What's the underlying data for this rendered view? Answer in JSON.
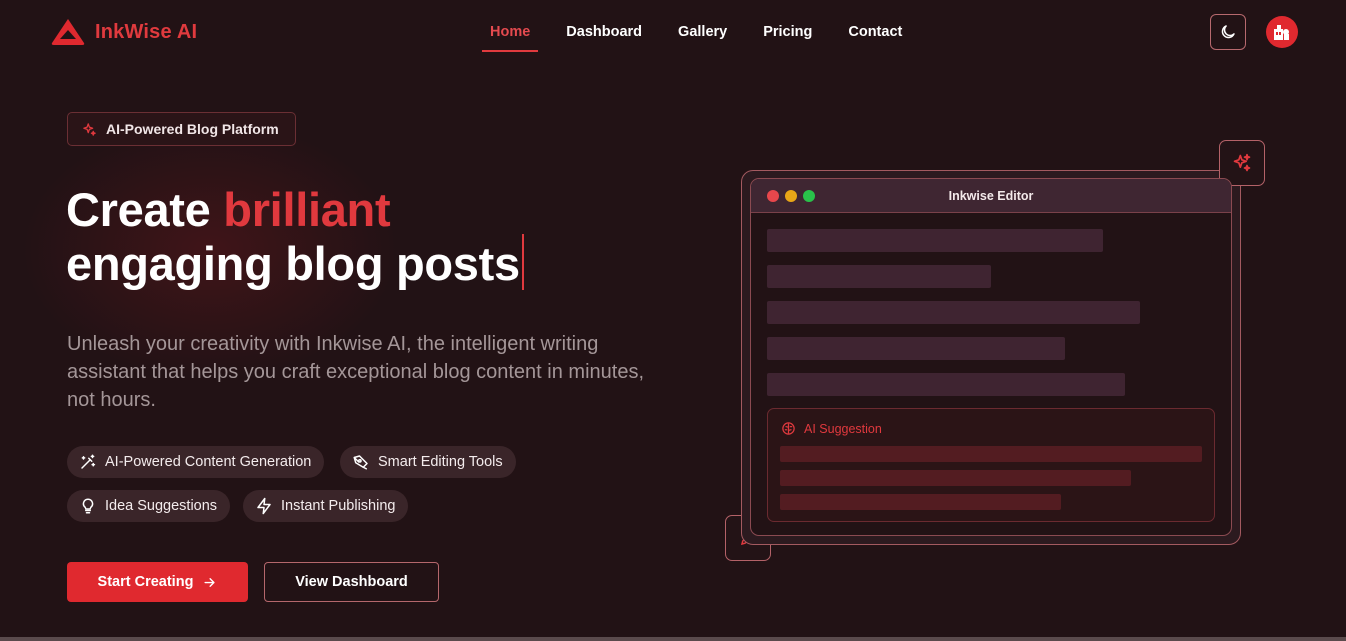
{
  "brand": {
    "name": "InkWise AI",
    "logo_icon": "red-triangle-logo",
    "accent": "#e0292f"
  },
  "nav": {
    "links": [
      "Home",
      "Dashboard",
      "Gallery",
      "Pricing",
      "Contact"
    ],
    "active": "Home",
    "theme_toggle_icon": "moon-icon",
    "avatar_icon": "user-avatar"
  },
  "hero": {
    "badge": "AI-Powered Blog Platform",
    "headline_part1": "Create",
    "headline_highlight": "brilliant",
    "headline_line2": "engaging blog posts",
    "subtitle": "Unleash your creativity with Inkwise AI, the intelligent writing assistant that helps you craft exceptional blog content in minutes, not hours.",
    "features": [
      {
        "label": "AI-Powered Content Generation",
        "icon": "magic-wand-icon"
      },
      {
        "label": "Smart Editing Tools",
        "icon": "pen-tool-icon"
      },
      {
        "label": "Idea Suggestions",
        "icon": "lightbulb-icon"
      },
      {
        "label": "Instant Publishing",
        "icon": "lightning-icon"
      }
    ],
    "cta_primary": "Start Creating",
    "cta_secondary": "View Dashboard"
  },
  "editor": {
    "title": "Inkwise Editor",
    "ai_suggestion_label": "AI Suggestion",
    "window_dots": [
      "#e8474c",
      "#e9a617",
      "#29c24a"
    ]
  }
}
